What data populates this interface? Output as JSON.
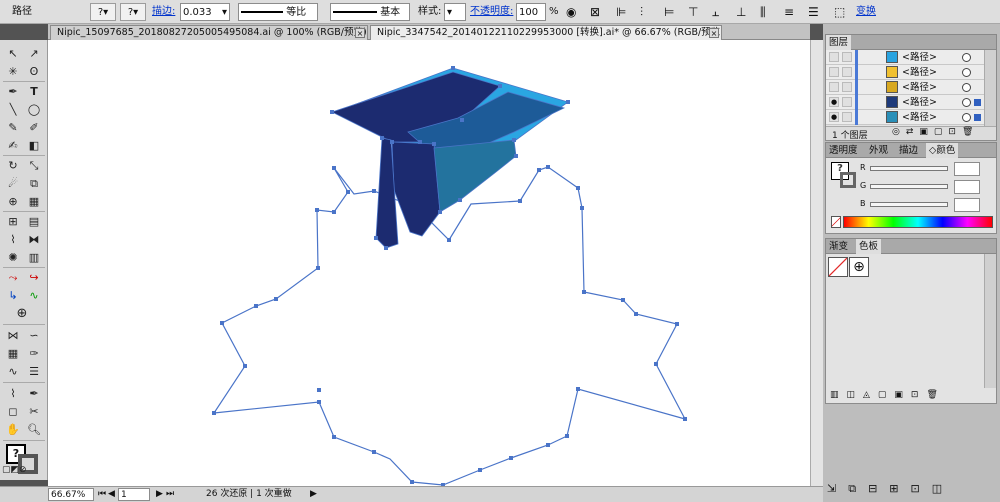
{
  "control_bar": {
    "object_type": "路径",
    "stroke_label": "描边:",
    "stroke_value": "0.033",
    "profile_label": "等比",
    "brush_label": "基本",
    "style_label": "样式:",
    "opacity_label": "不透明度:",
    "opacity_value": "100",
    "opacity_unit": "%",
    "convert_label": "变换"
  },
  "doc_tabs": [
    {
      "label": "Nipic_15097685_20180827205005495084.ai @ 100% (RGB/预览)",
      "close": "×"
    },
    {
      "label": "Nipic_3347542_20140122110229953000 [转换].ai* @ 66.67% (RGB/预览)",
      "close": "×"
    }
  ],
  "status_bar": {
    "zoom": "66.67%",
    "artboard": "1",
    "history": "26 次还原 | 1 次重做"
  },
  "layers_panel": {
    "title": "图层",
    "items": [
      {
        "name": "<路径>",
        "swatch": "#29a3e0"
      },
      {
        "name": "<路径>",
        "swatch": "#f0c030"
      },
      {
        "name": "<路径>",
        "swatch": "#d8a820"
      },
      {
        "name": "<路径>",
        "swatch": "#1e3a7a"
      },
      {
        "name": "<路径>",
        "swatch": "#2a8fb8"
      }
    ],
    "footer": "1 个图层"
  },
  "color_panel": {
    "tabs": [
      "透明度",
      "外观",
      "描边",
      "颜色"
    ],
    "active": "颜色",
    "channels": [
      "R",
      "G",
      "B"
    ]
  },
  "swatch_panel": {
    "tabs": [
      "渐变",
      "色板"
    ],
    "active": "色板"
  },
  "colors": {
    "path": "#4a74c8",
    "cap_dark": "#1c2b70",
    "cap_mid": "#1d5b98",
    "cap_light": "#2aa6e2",
    "cap_teal": "#23739e"
  }
}
